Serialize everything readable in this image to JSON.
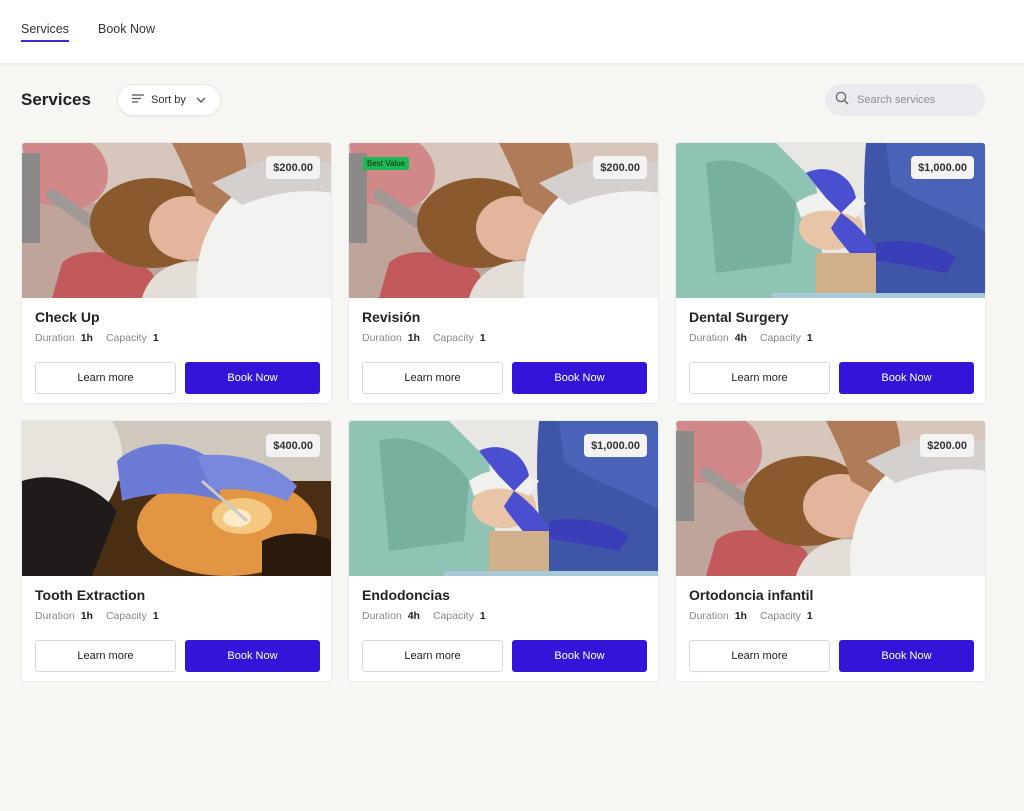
{
  "nav": {
    "tabs": [
      {
        "label": "Services",
        "active": true
      },
      {
        "label": "Book Now",
        "active": false
      }
    ]
  },
  "toolbar": {
    "title": "Services",
    "sort_label": "Sort by",
    "search_placeholder": "Search services"
  },
  "labels": {
    "duration": "Duration",
    "capacity": "Capacity",
    "learn_more": "Learn more",
    "book_now": "Book Now"
  },
  "colors": {
    "accent": "#3315d9",
    "badge": "#1db954"
  },
  "services": [
    {
      "name": "Check Up",
      "price": "$200.00",
      "duration": "1h",
      "capacity": "1",
      "badge": "",
      "image": "patient-checkup-photo"
    },
    {
      "name": "Revisión",
      "price": "$200.00",
      "duration": "1h",
      "capacity": "1",
      "badge": "Best Value",
      "image": "patient-checkup-photo"
    },
    {
      "name": "Dental Surgery",
      "price": "$1,000.00",
      "duration": "4h",
      "capacity": "1",
      "badge": "",
      "image": "surgery-photo"
    },
    {
      "name": "Tooth Extraction",
      "price": "$400.00",
      "duration": "1h",
      "capacity": "1",
      "badge": "",
      "image": "extraction-photo"
    },
    {
      "name": "Endodoncias",
      "price": "$1,000.00",
      "duration": "4h",
      "capacity": "1",
      "badge": "",
      "image": "surgery-photo"
    },
    {
      "name": "Ortodoncia infantil",
      "price": "$200.00",
      "duration": "1h",
      "capacity": "1",
      "badge": "",
      "image": "patient-checkup-photo"
    }
  ]
}
